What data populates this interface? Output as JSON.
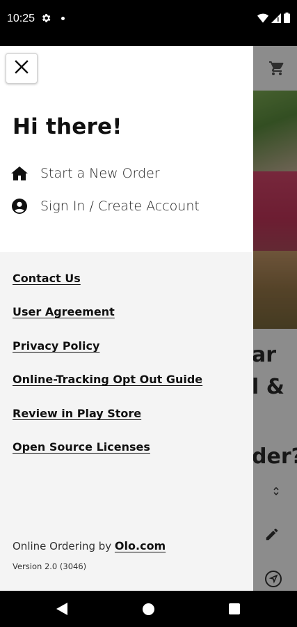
{
  "status_bar": {
    "time": "10:25"
  },
  "drawer": {
    "greeting": "Hi there!",
    "menu": [
      {
        "label": "Start a New Order",
        "icon": "home-icon"
      },
      {
        "label": "Sign In / Create Account",
        "icon": "account-circle-icon"
      }
    ],
    "links": [
      {
        "label": "Contact Us"
      },
      {
        "label": "User Agreement"
      },
      {
        "label": "Privacy Policy"
      },
      {
        "label": "Online-Tracking Opt Out Guide"
      },
      {
        "label": "Review in Play Store"
      },
      {
        "label": "Open Source Licenses"
      }
    ],
    "footer": {
      "prefix": "Online Ordering by ",
      "brand_link": "Olo.com",
      "version": "Version 2.0 (3046)"
    }
  },
  "background": {
    "text_lines": [
      "ar",
      "l &",
      "der?"
    ]
  },
  "colors": {
    "drawer_top": "#ffffff",
    "drawer_bottom": "#f4f4f4",
    "text": "#111111",
    "system_bar": "#000000"
  }
}
